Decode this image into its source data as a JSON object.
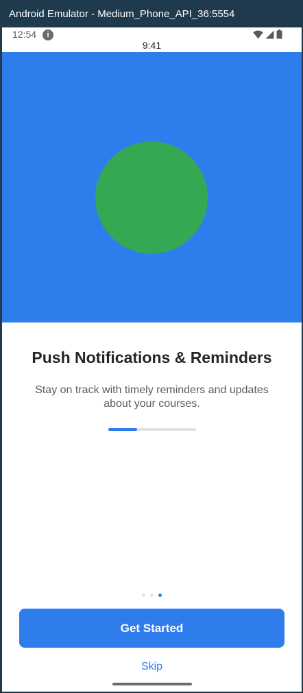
{
  "window": {
    "title": "Android Emulator - Medium_Phone_API_36:5554"
  },
  "statusbar": {
    "time": "12:54",
    "info_icon": "info-icon",
    "wifi_icon": "wifi-icon",
    "signal_icon": "signal-icon",
    "battery_icon": "battery-icon"
  },
  "app": {
    "time": "9:41"
  },
  "onboarding": {
    "title": "Push Notifications & Reminders",
    "subtitle": "Stay on track with timely reminders and updates about your courses.",
    "progress_fraction": 0.33,
    "page_count": 3,
    "current_page": 3,
    "primary_button": "Get Started",
    "skip_label": "Skip"
  },
  "colors": {
    "primary": "#2f7ded",
    "hero_background": "#2f7ded",
    "illustration": "#35a853",
    "title_text": "#262626",
    "subtitle_text": "#5c5c5c"
  }
}
